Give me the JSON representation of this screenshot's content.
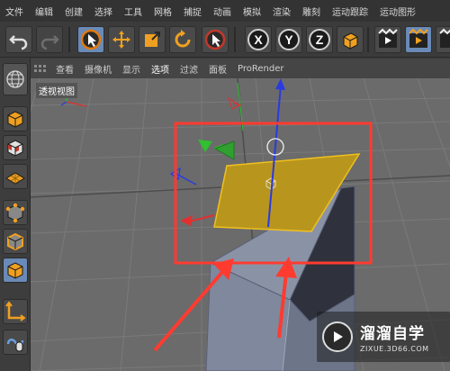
{
  "menubar": {
    "items": [
      "文件",
      "编辑",
      "创建",
      "选择",
      "工具",
      "网格",
      "捕捉",
      "动画",
      "模拟",
      "渲染",
      "雕刻",
      "运动跟踪",
      "运动图形"
    ]
  },
  "toolbar": {
    "buttons": [
      "undo-icon",
      "redo-icon",
      "select-cursor-icon",
      "move-icon",
      "scale-icon",
      "rotate-icon",
      "live-select-icon",
      "axis-x-icon",
      "axis-y-icon",
      "axis-z-icon",
      "world-coordinates-icon",
      "render-view-icon",
      "render-picture-queue-icon",
      "render-settings-icon"
    ],
    "axis_labels": {
      "x": "X",
      "y": "Y",
      "z": "Z"
    }
  },
  "viewport_menu": {
    "items": [
      "查看",
      "摄像机",
      "显示",
      "选项",
      "过滤",
      "面板",
      "ProRender"
    ],
    "active": "选项"
  },
  "viewport": {
    "label": "透视视图"
  },
  "watermark": {
    "title": "溜溜自学",
    "subtitle": "ZIXUE.3D66.COM"
  },
  "colors": {
    "highlight_box": "#ff3b30",
    "selected_polygon": "#b8961e",
    "arrow": "#ff3b30"
  }
}
